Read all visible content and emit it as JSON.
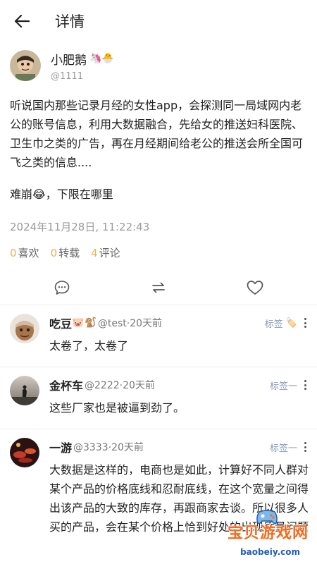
{
  "header": {
    "title": "详情"
  },
  "author": {
    "name": "小肥鹅",
    "emojis": "🦄🐣",
    "handle": "@1111"
  },
  "post": {
    "paragraphs": [
      "听说国内那些记录月经的女性app，会探测同一局域网内老公的账号信息，利用大数据融合，先给女的推送妇科医院、卫生巾之类的广告，再在月经期间给老公的推送会所全国可飞之类的信息....",
      "难崩😂，下限在哪里"
    ],
    "time": "2024年11月28日, 11:22:43"
  },
  "stats": {
    "likes_count": "0",
    "likes_label": "喜欢",
    "reposts_count": "0",
    "reposts_label": "转载",
    "comments_count": "4",
    "comments_label": "评论"
  },
  "comments": [
    {
      "name": "吃豆",
      "emojis": "🐷🐒",
      "meta": "@test·20天前",
      "tag": "标签",
      "tag_emoji": "🏷️",
      "text": "太卷了，太卷了"
    },
    {
      "name": "金杯车",
      "emojis": "",
      "meta": "@2222·20天前",
      "tag": "标签一",
      "tag_emoji": "",
      "text": "这些厂家也是被逼到劲了。"
    },
    {
      "name": "一游",
      "emojis": "",
      "meta": "@3333·20天前",
      "tag": "标签一",
      "tag_emoji": "",
      "text": "大数据是这样的，电商也是如此，计算好不同人群对某个产品的价格底线和忍耐底线，在这个宽量之间得出该产品的大致的库存，再跟商家去谈。所以很多人买的产品，会在某个价格上恰到好处的出现质量问题"
    }
  ],
  "watermark": {
    "title": "宝贝游戏网",
    "url": "baobeiy.com"
  },
  "colors": {
    "accent": "#e6b35a",
    "tag": "#8a9bb8",
    "watermark": "#f36b1f"
  }
}
